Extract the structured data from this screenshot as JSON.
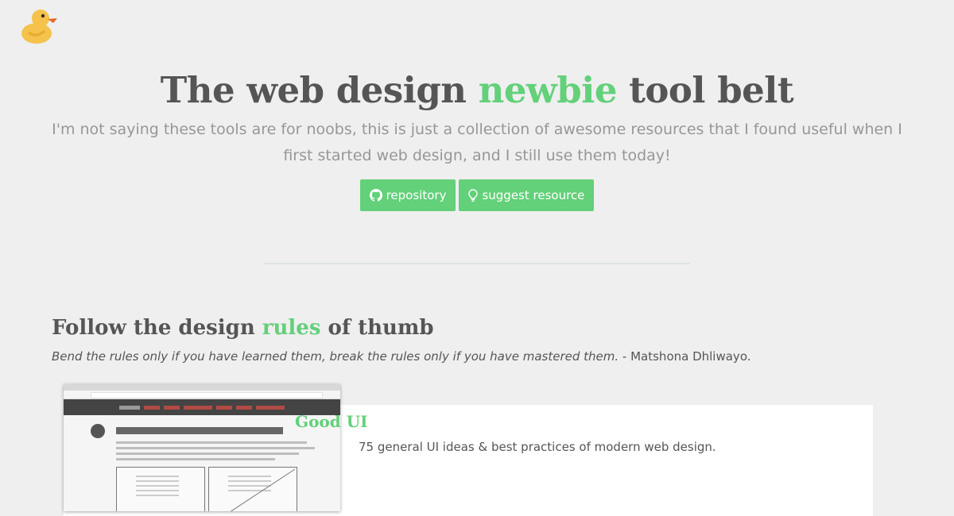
{
  "header": {
    "title_before": "The web design ",
    "title_accent": "newbie",
    "title_after": " tool belt",
    "subtitle": "I'm not saying these tools are for noobs, this is just a collection of awesome resources that I found useful when I first started web design, and I still use them today!"
  },
  "buttons": {
    "repository": "repository",
    "suggest": "suggest resource"
  },
  "section": {
    "title_before": "Follow the design ",
    "title_accent": "rules",
    "title_after": " of thumb",
    "quote": "Bend the rules only if you have learned them, break the rules only if you have mastered them.",
    "quote_author": "- Matshona Dhliwayo."
  },
  "card": {
    "title": "Good UI",
    "description": "75 general UI ideas & best practices of modern web design."
  },
  "icons": [
    "duck-logo",
    "github-icon",
    "lightbulb-icon"
  ],
  "colors": {
    "accent": "#63d07a",
    "background": "#efefef",
    "text": "#555555",
    "muted": "#979797"
  }
}
